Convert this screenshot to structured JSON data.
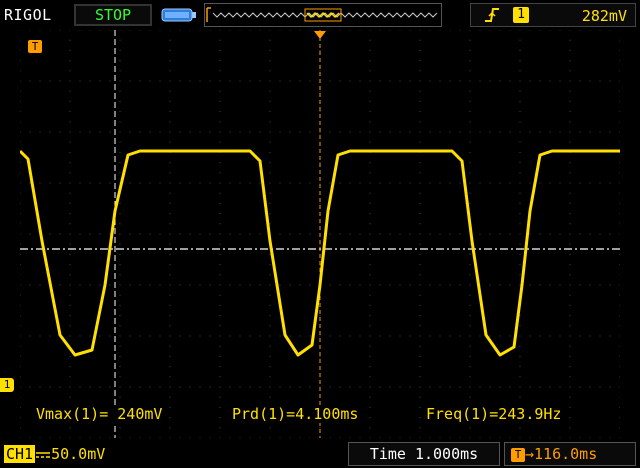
{
  "header": {
    "brand": "RIGOL",
    "run_state": "STOP",
    "trigger": {
      "edge_icon": "rising-edge-icon",
      "source": "1",
      "level": "282mV"
    }
  },
  "markers": {
    "trigger_position": "T",
    "channel": "1"
  },
  "measurements": {
    "vmax": "Vmax(1)= 240mV",
    "period": "Prd(1)=4.100ms",
    "frequency": "Freq(1)=243.9Hz"
  },
  "footer": {
    "channel_tag": "CH1",
    "channel_scale": "50.0mV",
    "timebase": "Time  1.000ms",
    "trigger_offset": "116.0ms"
  },
  "colors": {
    "trace": "#ffe000",
    "trigger": "#ff9d00",
    "grid": "#4a4a4a",
    "run_state": "#33ff33"
  }
}
